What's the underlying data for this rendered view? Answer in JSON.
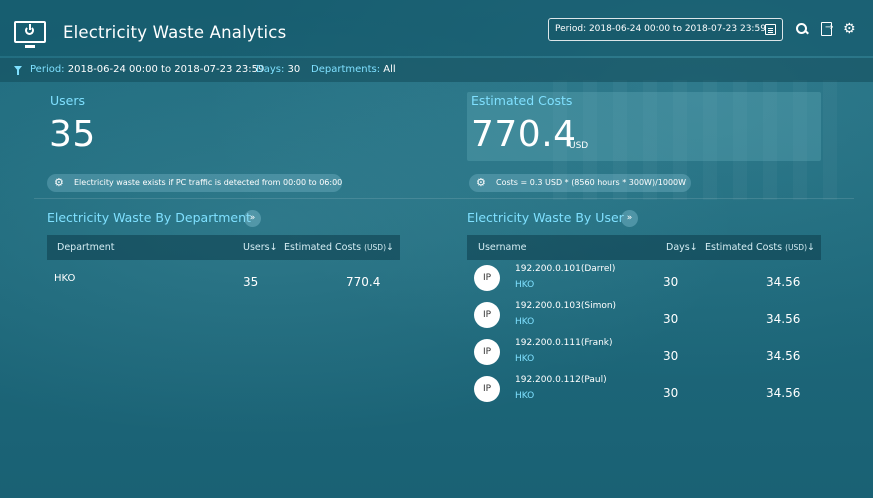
{
  "app": {
    "title": "Electricity Waste Analytics"
  },
  "header": {
    "period_text": "Period: 2018-06-24 00:00 to 2018-07-23 23:59",
    "icons": [
      "monitor-power-icon",
      "calendar-icon",
      "search-icon",
      "export-icon",
      "gear-icon"
    ]
  },
  "filterbar": {
    "period_label": "Period:",
    "period_value": "2018-06-24 00:00 to 2018-07-23 23:59",
    "days_label": "Days:",
    "days_value": "30",
    "departments_label": "Departments:",
    "departments_value": "All"
  },
  "users_kpi": {
    "title": "Users",
    "value": "35",
    "note": "Electricity waste exists if PC traffic is detected from 00:00 to 06:00"
  },
  "cost_kpi": {
    "title": "Estimated Costs",
    "value": "770.4",
    "unit": "USD",
    "note": "Costs = 0.3 USD * (8560 hours * 300W)/1000W"
  },
  "by_department": {
    "title": "Electricity Waste By Department",
    "expand": "»",
    "columns": {
      "department": "Department",
      "users": "Users↓",
      "costs": "Estimated Costs",
      "costs_unit": "(USD)",
      "costs_sort": "↓"
    },
    "rows": [
      {
        "department": "HKO",
        "users": "35",
        "costs": "770.4"
      }
    ]
  },
  "by_user": {
    "title": "Electricity Waste By User",
    "expand": "»",
    "columns": {
      "username": "Username",
      "days": "Days↓",
      "costs": "Estimated Costs",
      "costs_unit": "(USD)",
      "costs_sort": "↓"
    },
    "rows": [
      {
        "avatar": "IP",
        "name": "192.200.0.101(Darrel)",
        "dept": "HKO",
        "days": "30",
        "costs": "34.56"
      },
      {
        "avatar": "IP",
        "name": "192.200.0.103(Simon)",
        "dept": "HKO",
        "days": "30",
        "costs": "34.56"
      },
      {
        "avatar": "IP",
        "name": "192.200.0.111(Frank)",
        "dept": "HKO",
        "days": "30",
        "costs": "34.56"
      },
      {
        "avatar": "IP",
        "name": "192.200.0.112(Paul)",
        "dept": "HKO",
        "days": "30",
        "costs": "34.56"
      }
    ]
  }
}
